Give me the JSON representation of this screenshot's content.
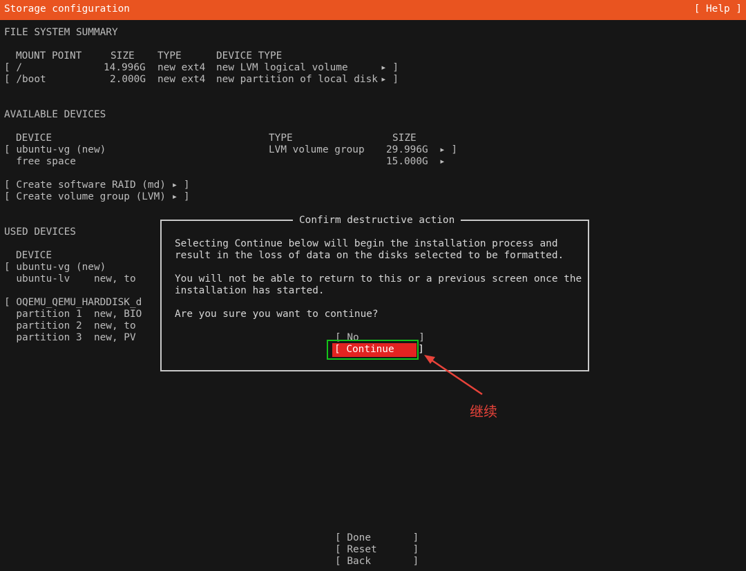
{
  "header": {
    "title": "Storage configuration",
    "help": "[ Help ]"
  },
  "fs_summary": {
    "heading": "FILE SYSTEM SUMMARY",
    "col_mount": "MOUNT POINT",
    "col_size": "SIZE",
    "col_type": "TYPE",
    "col_device_type": "DEVICE TYPE",
    "rows": [
      {
        "mount": "[ /",
        "size": "14.996G",
        "type": "new ext4",
        "device_type": "new LVM logical volume",
        "arrow": "▸ ]"
      },
      {
        "mount": "[ /boot",
        "size": "2.000G",
        "type": "new ext4",
        "device_type": "new partition of local disk",
        "arrow": "▸ ]"
      }
    ]
  },
  "available": {
    "heading": "AVAILABLE DEVICES",
    "col_device": "DEVICE",
    "col_type": "TYPE",
    "col_size": "SIZE",
    "rows": [
      {
        "device": "[ ubuntu-vg (new)",
        "type": "LVM volume group",
        "size": "29.996G",
        "arrow": "▸ ]"
      },
      {
        "device": "  free space",
        "type": "",
        "size": "15.000G",
        "arrow": "▸"
      }
    ],
    "raid": "[ Create software RAID (md) ▸ ]",
    "lvm": "[ Create volume group (LVM) ▸ ]"
  },
  "used": {
    "heading": "USED DEVICES",
    "col_device": "DEVICE",
    "rows": [
      "[ ubuntu-vg (new)",
      "  ubuntu-lv    new, to",
      "",
      "[ OQEMU_QEMU_HARDDISK_d",
      "  partition 1  new, BIO",
      "  partition 2  new, to",
      "  partition 3  new, PV"
    ]
  },
  "dialog": {
    "title": "Confirm destructive action",
    "line1": "Selecting Continue below will begin the installation process and",
    "line2": "result in the loss of data on the disks selected to be formatted.",
    "line3": "You will not be able to return to this or a previous screen once the",
    "line4": "installation has started.",
    "question": "Are you sure you want to continue?",
    "no_button": "[ No          ]",
    "continue_button": "[ Continue    ]"
  },
  "footer": {
    "done": "[ Done       ]",
    "reset": "[ Reset      ]",
    "back": "[ Back       ]"
  },
  "annotation": {
    "text": "继续",
    "color": "#e8433a",
    "box_color": "#14c21a"
  }
}
